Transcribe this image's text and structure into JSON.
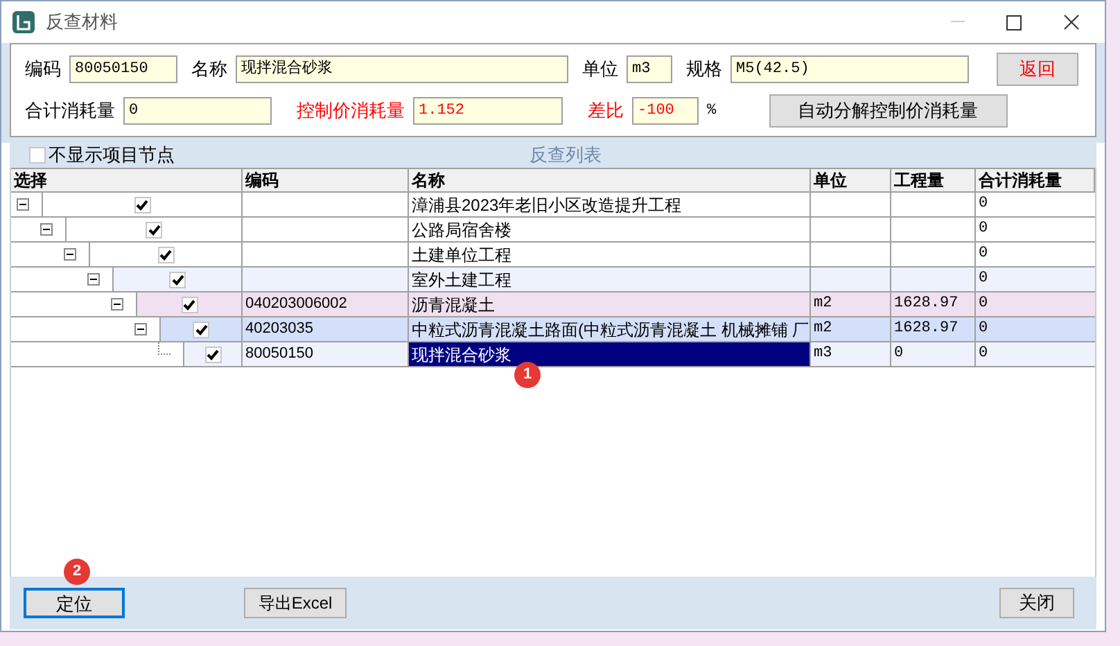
{
  "window": {
    "title": "反查材料"
  },
  "header": {
    "row_1": [
      {
        "label": "编码",
        "value": "80050150",
        "alert": false
      },
      {
        "label": "名称",
        "value": "现拌混合砂浆",
        "alert": false
      },
      {
        "label": "单位",
        "value": "m3",
        "alert": false
      },
      {
        "label": "规格",
        "value": "M5(42.5)",
        "alert": false
      }
    ],
    "row_2": [
      {
        "label": "合计消耗量",
        "value": "0",
        "alert": false
      },
      {
        "label": "控制价消耗量",
        "value": "1.152",
        "alert": true
      },
      {
        "label": "差比",
        "value": "-100",
        "alert": true,
        "suffix": "%"
      }
    ],
    "back_button": "返回",
    "auto_button": "自动分解控制价消耗量"
  },
  "list": {
    "title": "反查列表",
    "hide_nodes": {
      "label": "不显示项目节点",
      "checked": false
    },
    "columns": [
      "选择",
      "编码",
      "名称",
      "单位",
      "工程量",
      "合计消耗量"
    ],
    "rows": [
      {
        "name": "漳浦县2023年老旧小区改造提升工程",
        "total": "0",
        "checked": true,
        "expanded": true,
        "selected": false,
        "color": "#ffffff",
        "children": [
          {
            "name": "公路局宿舍楼",
            "total": "0",
            "checked": true,
            "expanded": true,
            "selected": false,
            "color": "#ffffff",
            "children": [
              {
                "name": "土建单位工程",
                "total": "0",
                "checked": true,
                "expanded": true,
                "selected": false,
                "color": "#ffffff",
                "children": [
                  {
                    "name": "室外土建工程",
                    "total": "0",
                    "checked": true,
                    "expanded": true,
                    "selected": false,
                    "color": "#eef2fc",
                    "children": [
                      {
                        "code": "040203006002",
                        "name": "沥青混凝土",
                        "unit": "m2",
                        "quantity": "1628.97",
                        "total": "0",
                        "checked": true,
                        "expanded": true,
                        "selected": false,
                        "color": "#f0e0f0",
                        "children": [
                          {
                            "code": "40203035",
                            "name": "中粒式沥青混凝土路面(中粒式沥青混凝土 机械摊铺 厂",
                            "unit": "m2",
                            "quantity": "1628.97",
                            "total": "0",
                            "checked": true,
                            "expanded": true,
                            "selected": false,
                            "color": "#d4e0fa",
                            "children": [
                              {
                                "code": "80050150",
                                "name": "现拌混合砂浆",
                                "unit": "m3",
                                "quantity": "0",
                                "total": "0",
                                "checked": true,
                                "selected": true,
                                "color": "#eef2fc"
                              }
                            ]
                          }
                        ]
                      }
                    ]
                  }
                ]
              }
            ]
          }
        ]
      }
    ]
  },
  "footer": {
    "locate_button": "定位",
    "export_button": "导出Excel",
    "close_button": "关闭"
  },
  "markers": [
    "1",
    "2"
  ]
}
